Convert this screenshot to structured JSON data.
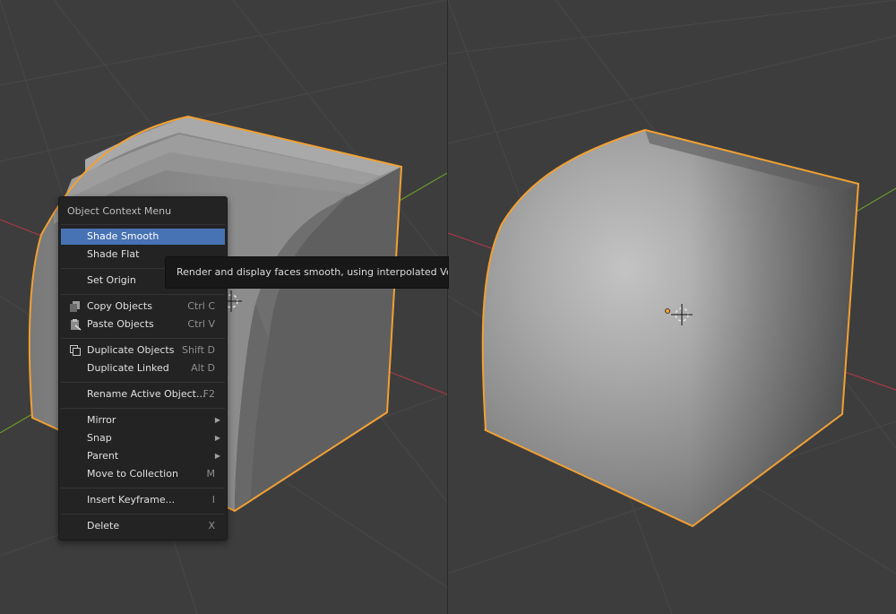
{
  "context_menu": {
    "title": "Object Context Menu",
    "items": [
      {
        "label": "Shade Smooth",
        "shortcut": "",
        "active": true
      },
      {
        "label": "Shade Flat",
        "shortcut": ""
      },
      {
        "label": "Set Origin",
        "shortcut": "",
        "submenu": true
      },
      {
        "label": "Copy Objects",
        "shortcut": "Ctrl C",
        "icon": "copy-icon"
      },
      {
        "label": "Paste Objects",
        "shortcut": "Ctrl V",
        "icon": "paste-icon"
      },
      {
        "label": "Duplicate Objects",
        "shortcut": "Shift D",
        "icon": "duplicate-icon"
      },
      {
        "label": "Duplicate Linked",
        "shortcut": "Alt D"
      },
      {
        "label": "Rename Active Object...",
        "shortcut": "F2"
      },
      {
        "label": "Mirror",
        "shortcut": "",
        "submenu": true
      },
      {
        "label": "Snap",
        "shortcut": "",
        "submenu": true
      },
      {
        "label": "Parent",
        "shortcut": "",
        "submenu": true
      },
      {
        "label": "Move to Collection",
        "shortcut": "M"
      },
      {
        "label": "Insert Keyframe...",
        "shortcut": "I"
      },
      {
        "label": "Delete",
        "shortcut": "X"
      }
    ]
  },
  "tooltip": {
    "text": "Render and display faces smooth, using interpolated Vertex N"
  },
  "colors": {
    "viewport_bg": "#3d3d3d",
    "grid_line": "#484848",
    "x_axis": "#a5394a",
    "y_axis": "#6a962c",
    "selection_outline": "#f2a033",
    "menu_bg": "#232323",
    "menu_highlight": "#4772b3"
  }
}
